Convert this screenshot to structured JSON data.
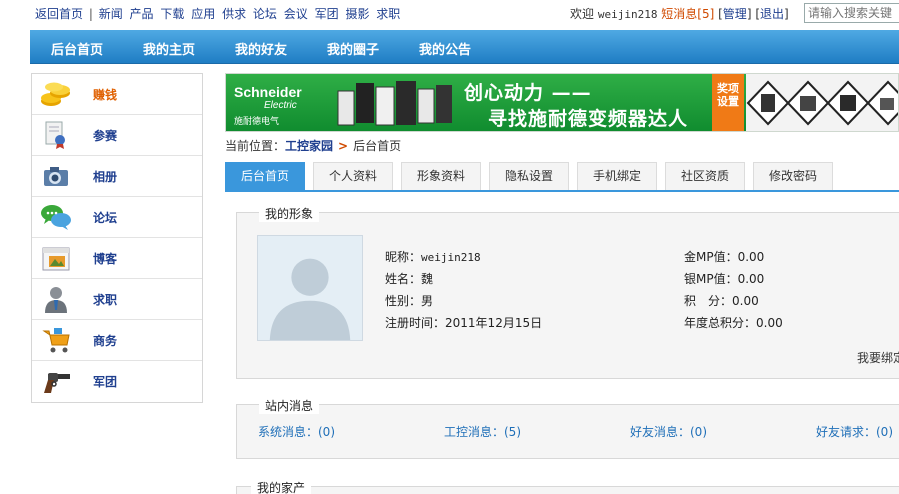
{
  "topbar": {
    "links": [
      "返回首页",
      "新闻",
      "产品",
      "下载",
      "应用",
      "供求",
      "论坛",
      "会议",
      "军团",
      "摄影",
      "求职"
    ],
    "welcome": "欢迎",
    "username": "weijin218",
    "messages": "短消息[5]",
    "manage": "管理",
    "logout": "退出",
    "search_placeholder": "请输入搜索关键"
  },
  "navbar": {
    "items": [
      "后台首页",
      "我的主页",
      "我的好友",
      "我的圈子",
      "我的公告"
    ]
  },
  "sidebar": {
    "items": [
      {
        "label": "赚钱",
        "icon": "coins-icon"
      },
      {
        "label": "参赛",
        "icon": "award-certificate-icon"
      },
      {
        "label": "相册",
        "icon": "camera-icon"
      },
      {
        "label": "论坛",
        "icon": "chat-bubbles-icon"
      },
      {
        "label": "博客",
        "icon": "folder-image-icon"
      },
      {
        "label": "求职",
        "icon": "person-icon"
      },
      {
        "label": "商务",
        "icon": "shopping-cart-icon"
      },
      {
        "label": "军团",
        "icon": "revolver-icon"
      }
    ]
  },
  "banner": {
    "brand": "Schneider",
    "brand_sub": "Electric",
    "brand_cn": "施耐德电气",
    "slogan_line1": "创心动力 ——",
    "slogan_line2": "寻找施耐德变频器达人",
    "award": "奖项设置"
  },
  "breadcrumb": {
    "prefix": "当前位置：",
    "home": "工控家园",
    "current": "后台首页"
  },
  "tabs": [
    "后台首页",
    "个人资料",
    "形象资料",
    "隐私设置",
    "手机绑定",
    "社区资质",
    "修改密码"
  ],
  "profile": {
    "legend": "我的形象",
    "nickname_label": "昵称：",
    "nickname": "weijin218",
    "name_label": "姓名：",
    "name": "魏",
    "gender_label": "性别：",
    "gender": "男",
    "register_label": "注册时间：",
    "register_date": "2011年12月15日",
    "gold_label": "金MP值：",
    "gold": "0.00",
    "silver_label": "银MP值：",
    "silver": "0.00",
    "points_label": "积　分：",
    "points": "0.00",
    "annual_label": "年度总积分：",
    "annual": "0.00",
    "bind_link": "我要绑定"
  },
  "messages_panel": {
    "legend": "站内消息",
    "system": "系统消息：(0)",
    "industrial": "工控消息：(5)",
    "friend": "好友消息：(0)",
    "friend_request": "好友请求：(0)"
  },
  "assets_panel": {
    "legend": "我的家产"
  }
}
